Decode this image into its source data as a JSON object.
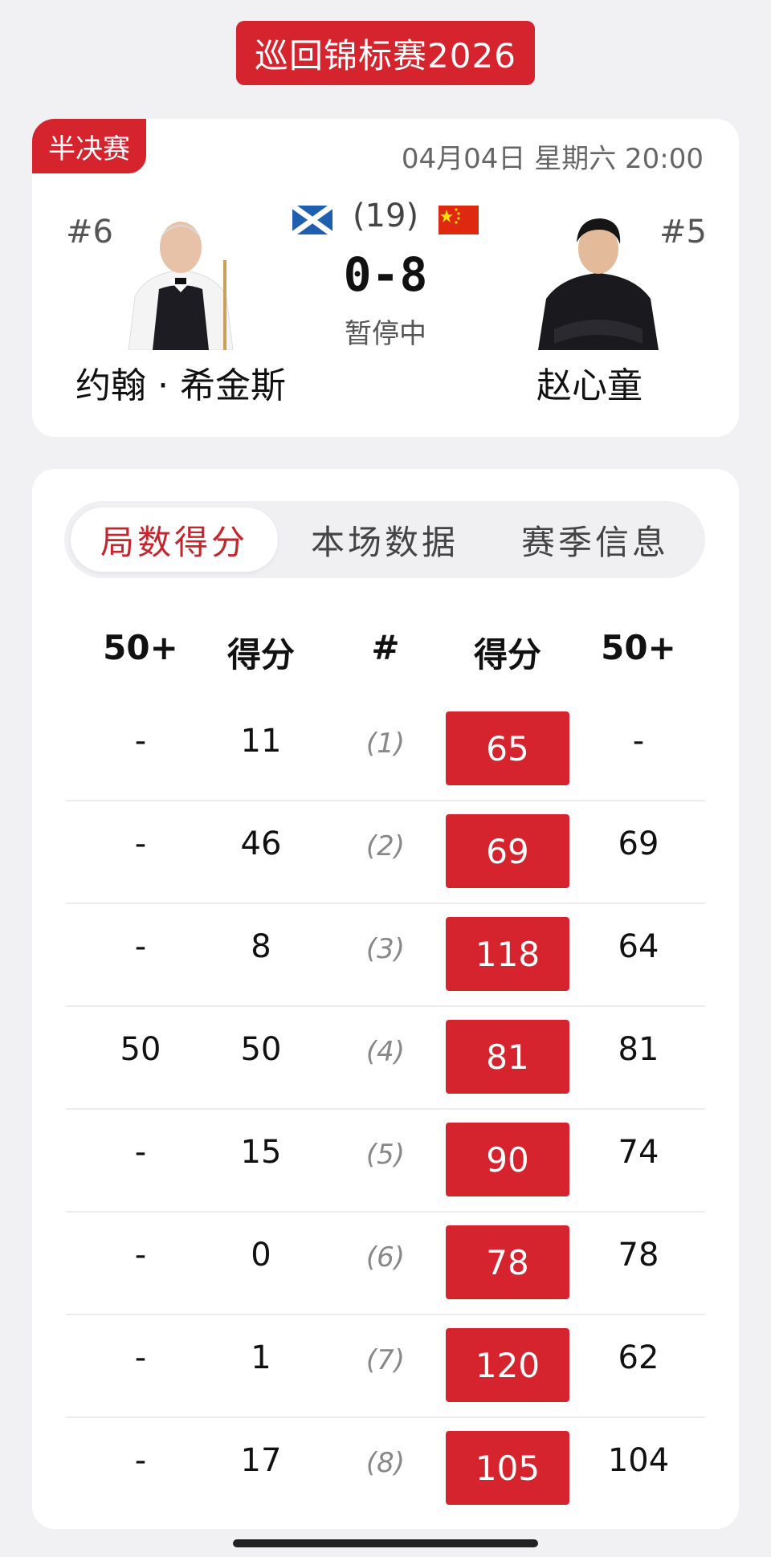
{
  "tournament_title": "巡回锦标赛2026",
  "match": {
    "round": "半决赛",
    "datetime": "04月04日 星期六 20:00",
    "best_of": "(19)",
    "score": "0-8",
    "status": "暂停中",
    "left_player": {
      "rank": "#6",
      "name": "约翰 · 希金斯",
      "flag": "scotland-flag-icon"
    },
    "right_player": {
      "rank": "#5",
      "name": "赵心童",
      "flag": "china-flag-icon"
    }
  },
  "tabs": [
    {
      "label": "局数得分",
      "active": true
    },
    {
      "label": "本场数据",
      "active": false
    },
    {
      "label": "赛季信息",
      "active": false
    }
  ],
  "table": {
    "headers": [
      "50+",
      "得分",
      "#",
      "得分",
      "50+"
    ],
    "rows": [
      [
        "-",
        "11",
        "(1)",
        "65",
        "-"
      ],
      [
        "-",
        "46",
        "(2)",
        "69",
        "69"
      ],
      [
        "-",
        "8",
        "(3)",
        "118",
        "64"
      ],
      [
        "50",
        "50",
        "(4)",
        "81",
        "81"
      ],
      [
        "-",
        "15",
        "(5)",
        "90",
        "74"
      ],
      [
        "-",
        "0",
        "(6)",
        "78",
        "78"
      ],
      [
        "-",
        "1",
        "(7)",
        "120",
        "62"
      ],
      [
        "-",
        "17",
        "(8)",
        "105",
        "104"
      ]
    ]
  },
  "colors": {
    "accent": "#d5242d",
    "background": "#f1f1f3"
  }
}
